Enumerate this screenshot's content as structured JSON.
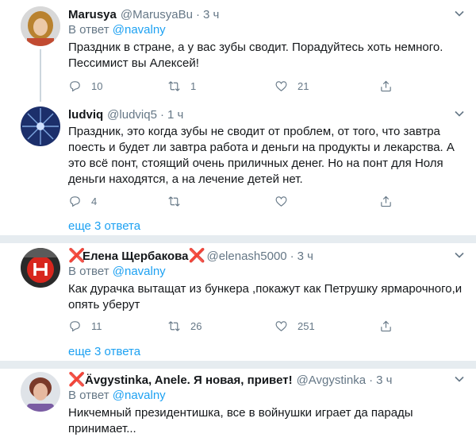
{
  "colors": {
    "accent": "#1da1f2",
    "secondary_text": "#657786",
    "separator": "#e6ecf0",
    "red_cross": "#dd2e44"
  },
  "tweets": [
    {
      "name": "Marusya",
      "handle": "@MarusyaBu",
      "time": "3 ч",
      "reply_label": "В ответ",
      "reply_to": "@navalny",
      "text": "Праздник в стране, а у вас зубы сводит. Порадуйтесь хоть немного. Пессимист вы Алексей!",
      "replies": "10",
      "retweets": "1",
      "likes": "21"
    },
    {
      "name": "ludviq",
      "handle": "@ludviq5",
      "time": "1 ч",
      "text": "Праздник, это когда зубы не сводит от проблем, от того, что завтра поесть и будет ли завтра работа и деньги на продукты и лекарства. А это всё понт, стоящий очень приличных денег. Но на понт для Ноля деньги находятся, а на лечение детей нет.",
      "replies": "4",
      "retweets": "",
      "likes": "",
      "more": "еще 3 ответа"
    },
    {
      "name_prefix": "❌",
      "name": "Елена Щербакова",
      "name_suffix": "❌",
      "handle": "@elenash5000",
      "time": "3 ч",
      "reply_label": "В ответ",
      "reply_to": "@navalny",
      "text": "Как дурачка вытащат из бункера ,покажут как Петрушку ярмарочного,и опять уберут",
      "replies": "11",
      "retweets": "26",
      "likes": "251",
      "more": "еще 3 ответа"
    },
    {
      "name_prefix": "❌",
      "name": "Ävgystinka, Anele. Я новая, привет!",
      "handle": "@Avgystinka",
      "time": "3 ч",
      "reply_label": "В ответ",
      "reply_to": "@navalny",
      "text": "Никчемный президентишка, все в войнушки играет да парады принимает..."
    }
  ]
}
